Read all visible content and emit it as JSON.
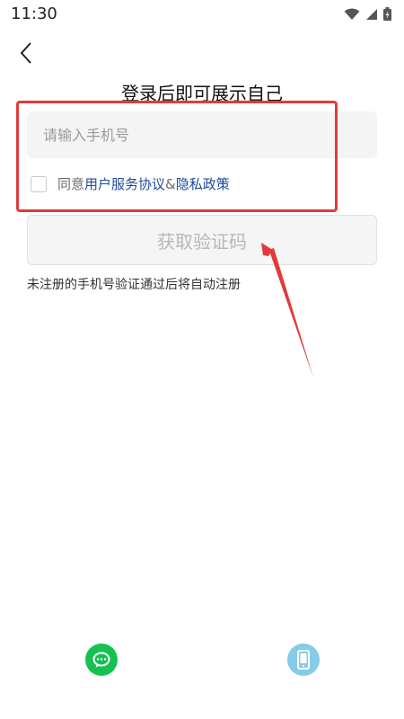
{
  "status": {
    "time": "11:30"
  },
  "title": "登录后即可展示自己",
  "phone": {
    "placeholder": "请输入手机号",
    "value": ""
  },
  "agreement": {
    "prefix": "同意",
    "terms_link": "用户服务协议",
    "amp": "&",
    "privacy_link": "隐私政策",
    "checked": false
  },
  "get_code_button": "获取验证码",
  "note": "未注册的手机号验证通过后将自动注册",
  "icons": {
    "back": "back-arrow-icon",
    "wechat": "wechat-icon",
    "phone_login": "phone-login-icon"
  },
  "colors": {
    "highlight_box": "#e23a3a",
    "link": "#1d4b9c",
    "wechat": "#16c152",
    "phone_login": "#86cbe8"
  }
}
